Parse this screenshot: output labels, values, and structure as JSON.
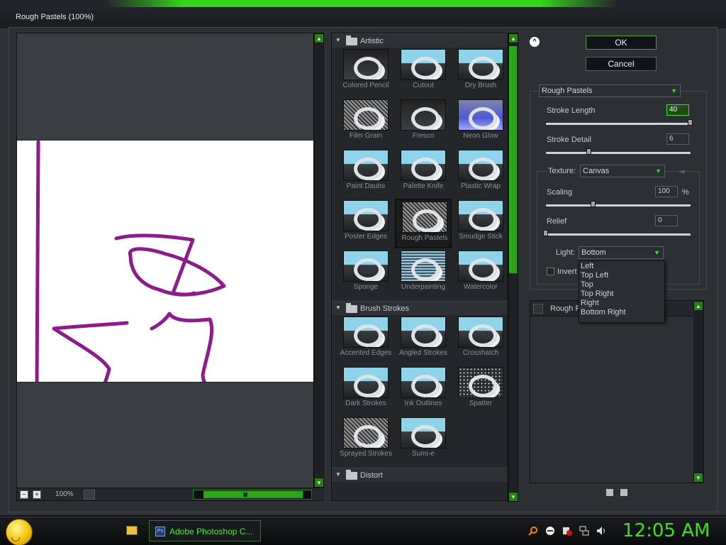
{
  "window": {
    "title": "Rough Pastels (100%)"
  },
  "preview": {
    "zoom": "100%",
    "zoom_out": "−",
    "zoom_in": "+"
  },
  "gallery": {
    "categories": [
      {
        "name": "Artistic",
        "items": [
          "Colored Pencil",
          "Cutout",
          "Dry Brush",
          "Film Grain",
          "Fresco",
          "Neon Glow",
          "Paint Daubs",
          "Palette Knife",
          "Plastic Wrap",
          "Poster Edges",
          "Rough Pastels",
          "Smudge Stick",
          "Sponge",
          "Underpainting",
          "Watercolor"
        ]
      },
      {
        "name": "Brush Strokes",
        "items": [
          "Accented Edges",
          "Angled Strokes",
          "Crosshatch",
          "Dark Strokes",
          "Ink Outlines",
          "Spatter",
          "Sprayed Strokes",
          "Sumi-e"
        ]
      },
      {
        "name": "Distort",
        "items": []
      }
    ],
    "selected": "Rough Pastels"
  },
  "buttons": {
    "ok": "OK",
    "cancel": "Cancel",
    "collapse": "^"
  },
  "settings": {
    "filter": "Rough Pastels",
    "stroke_length": {
      "label": "Stroke Length",
      "value": "40",
      "level": 1.0
    },
    "stroke_detail": {
      "label": "Stroke Detail",
      "value": "6",
      "level": 0.3
    },
    "texture": {
      "label": "Texture:",
      "value": "Canvas"
    },
    "scaling": {
      "label": "Scaling",
      "value": "100",
      "unit": "%",
      "level": 0.33
    },
    "relief": {
      "label": "Relief",
      "value": "0",
      "level": 0.0
    },
    "light": {
      "label": "Light:",
      "value": "Bottom",
      "options": [
        "Left",
        "Top Left",
        "Top",
        "Top Right",
        "Right",
        "Bottom Right"
      ]
    },
    "invert": {
      "label": "Invert"
    }
  },
  "layers": {
    "name": "Rough P"
  },
  "taskbar": {
    "task": "Adobe Photoshop C...",
    "clock": "12:05 AM"
  },
  "colors": {
    "accent": "#35d41a",
    "stroke": "#8e1b8c"
  }
}
